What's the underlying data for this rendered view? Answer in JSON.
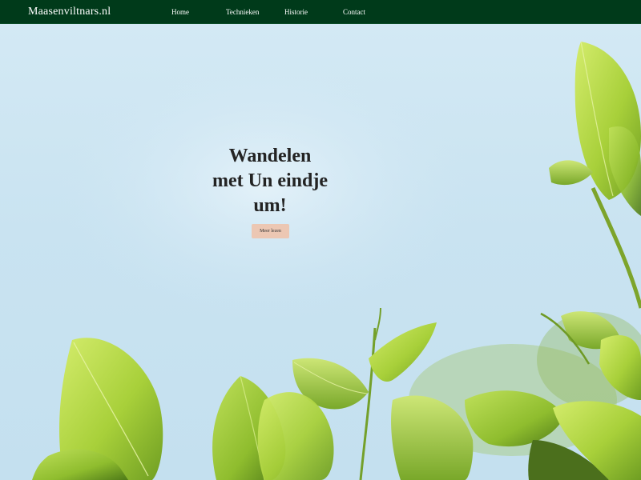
{
  "header": {
    "brand": "Maasenviltnars.nl",
    "nav": [
      {
        "label": "Home"
      },
      {
        "label": "Technieken"
      },
      {
        "label": "Historie"
      },
      {
        "label": "Contact"
      }
    ]
  },
  "hero": {
    "title_lines": [
      "Wandelen",
      "met Un eindje",
      "um!"
    ],
    "button_label": "Meer lezen",
    "background_image": "leaves-against-sky"
  },
  "colors": {
    "navbar": "#003a1a",
    "accent_button": "#ecc7b3",
    "sky": "#cfe6f3",
    "leaf": "#a6cf3a"
  }
}
